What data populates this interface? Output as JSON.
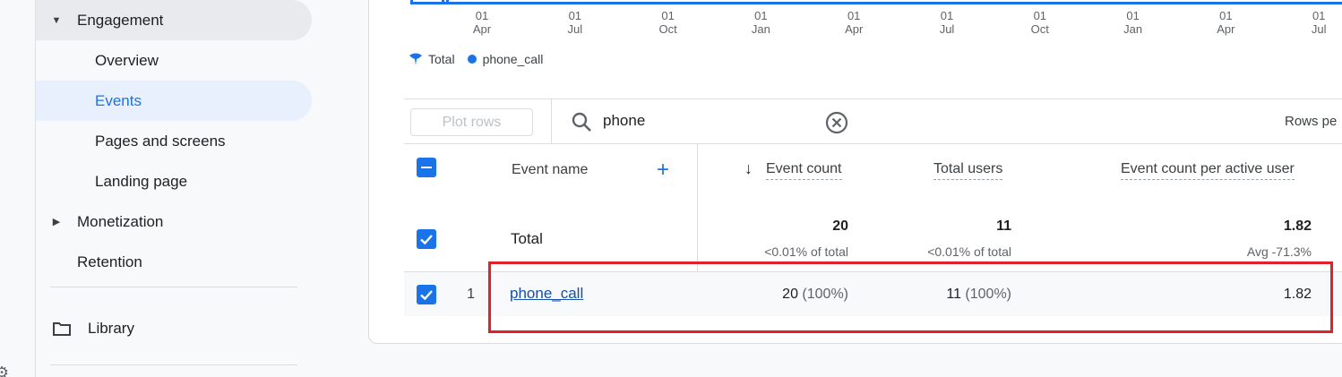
{
  "nav": {
    "engagement": "Engagement",
    "overview": "Overview",
    "events": "Events",
    "pages_and_screens": "Pages and screens",
    "landing_page": "Landing page",
    "monetization": "Monetization",
    "retention": "Retention",
    "library": "Library"
  },
  "chart": {
    "x_labels": [
      {
        "day": "01",
        "month": "Apr"
      },
      {
        "day": "01",
        "month": "Jul"
      },
      {
        "day": "01",
        "month": "Oct"
      },
      {
        "day": "01",
        "month": "Jan"
      },
      {
        "day": "01",
        "month": "Apr"
      },
      {
        "day": "01",
        "month": "Jul"
      },
      {
        "day": "01",
        "month": "Oct"
      },
      {
        "day": "01",
        "month": "Jan"
      },
      {
        "day": "01",
        "month": "Apr"
      },
      {
        "day": "01",
        "month": "Jul"
      }
    ],
    "legend": {
      "total": "Total",
      "series": "phone_call"
    },
    "series_color": "#1a73e8"
  },
  "toolbar": {
    "plot_rows": "Plot rows",
    "search_value": "phone",
    "rows_per_page": "Rows pe"
  },
  "table": {
    "headers": {
      "event_name": "Event name",
      "event_count": "Event count",
      "total_users": "Total users",
      "event_count_per_user": "Event count per active user"
    },
    "total": {
      "label": "Total",
      "event_count": "20",
      "event_count_sub": "<0.01% of total",
      "total_users": "11",
      "total_users_sub": "<0.01% of total",
      "per_user": "1.82",
      "per_user_sub": "Avg -71.3%"
    },
    "rows": [
      {
        "index": "1",
        "name": "phone_call",
        "event_count": "20",
        "event_count_pct": "(100%)",
        "total_users": "11",
        "total_users_pct": "(100%)",
        "per_user": "1.82"
      }
    ]
  },
  "colors": {
    "accent": "#1a73e8",
    "highlight": "#e0202a"
  }
}
